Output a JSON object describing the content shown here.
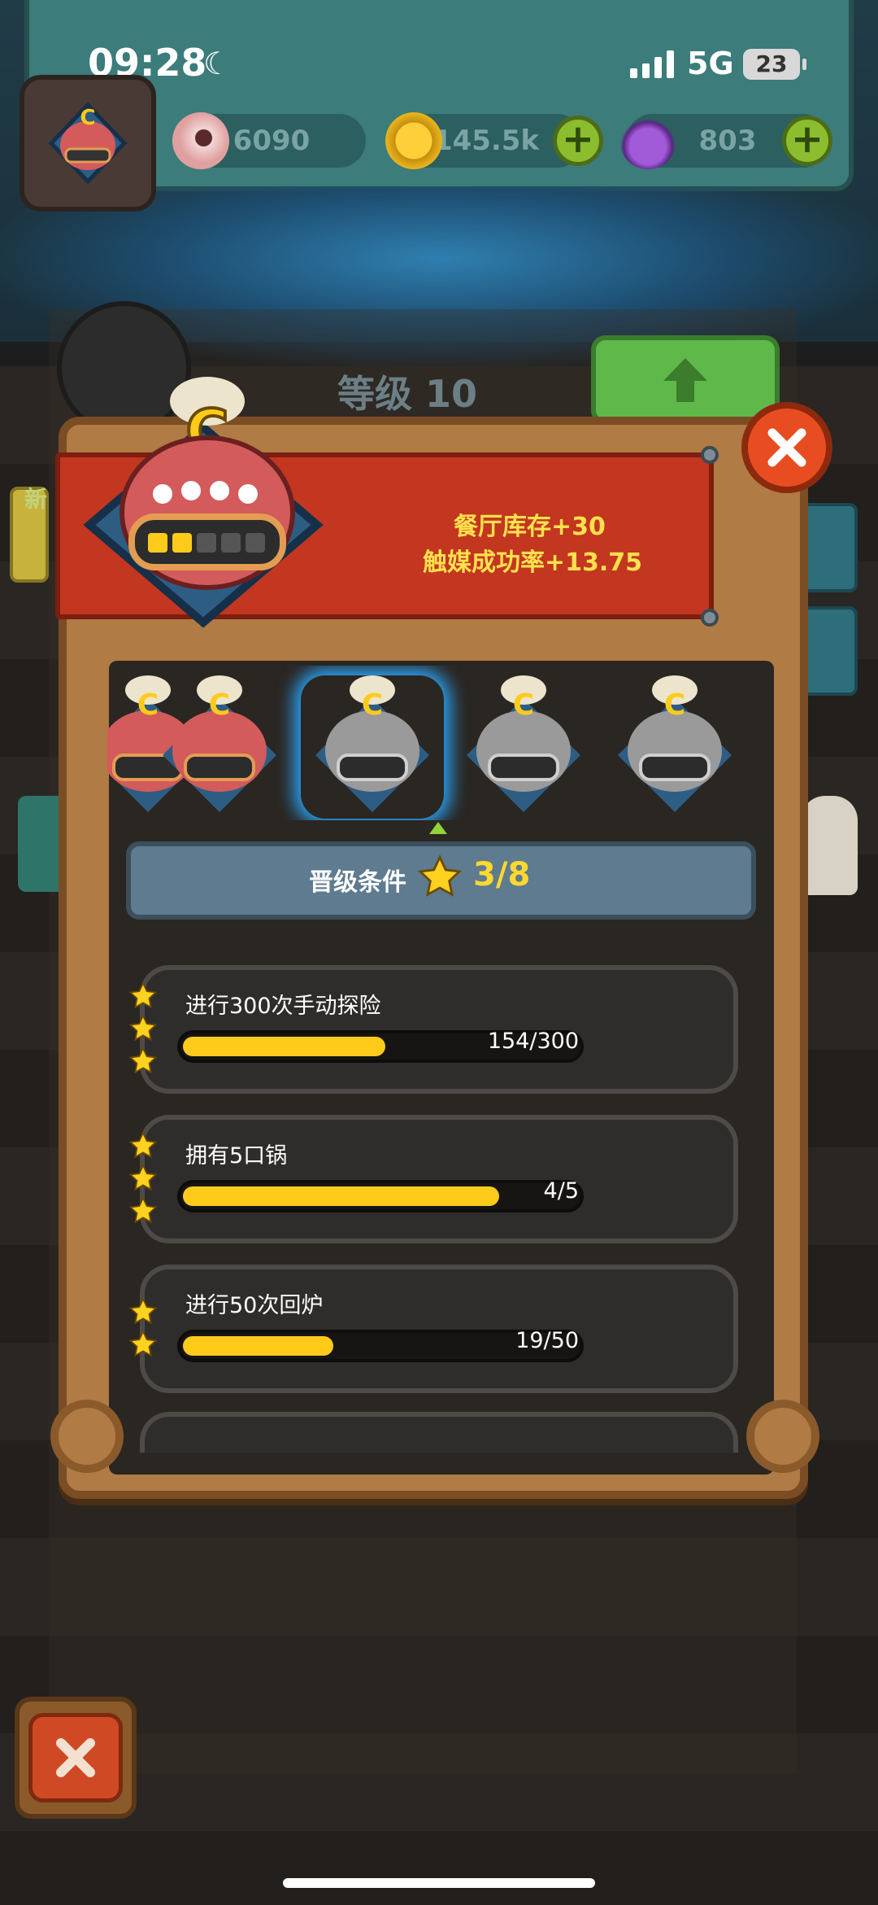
{
  "status_bar": {
    "time": "09:28",
    "network": "5G",
    "battery": "23"
  },
  "resources": [
    {
      "icon": "eyeball-icon",
      "value": "6090"
    },
    {
      "icon": "coin-icon",
      "value": "145.5k"
    },
    {
      "icon": "potion-icon",
      "value": "803"
    }
  ],
  "background": {
    "level_label": "等级 10",
    "side_new": "新"
  },
  "upgrade_panel": {
    "bonus_lines": [
      "餐厅库存+30",
      "触媒成功率+13.75"
    ],
    "character_letter": "C",
    "carousel": [
      {
        "state": "unlocked",
        "pips_filled": 5
      },
      {
        "state": "unlocked",
        "pips_filled": 4
      },
      {
        "state": "selected",
        "pips_filled": 3
      },
      {
        "state": "locked",
        "pips_filled": 4
      },
      {
        "state": "locked",
        "pips_filled": 5
      }
    ],
    "requirement": {
      "label": "晋级条件",
      "count": "3/8"
    },
    "tasks": [
      {
        "title": "进行300次手动探险",
        "progress": "154/300",
        "fraction": 0.513,
        "stars": 3
      },
      {
        "title": "拥有5口锅",
        "progress": "4/5",
        "fraction": 0.8,
        "stars": 3
      },
      {
        "title": "进行50次回炉",
        "progress": "19/50",
        "fraction": 0.38,
        "stars": 2
      }
    ]
  },
  "colors": {
    "accent_yellow": "#ffcb1a",
    "banner_red": "#c3361f",
    "wood": "#b07b44",
    "bonus_text": "#ffe14d"
  }
}
